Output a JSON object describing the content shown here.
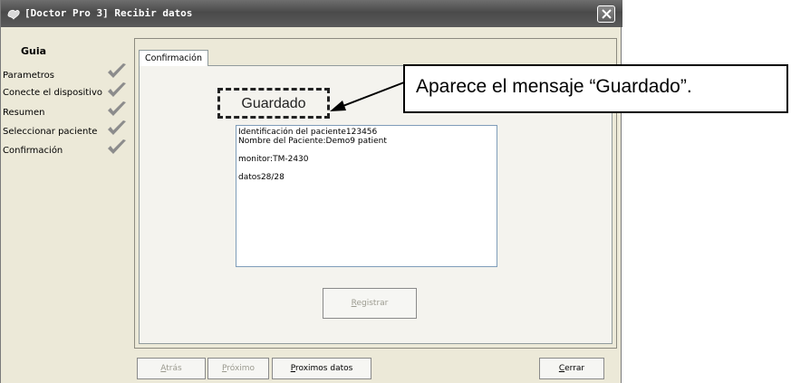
{
  "window": {
    "title": "[Doctor Pro 3] Recibir datos"
  },
  "guide": {
    "title": "Guia",
    "items": [
      {
        "label": "Parametros",
        "icon": "check-icon"
      },
      {
        "label": "Conecte el dispositivo",
        "icon": "check-icon"
      },
      {
        "label": "Resumen",
        "icon": "check-icon"
      },
      {
        "label": "Seleccionar paciente",
        "icon": "check-icon"
      },
      {
        "label": "Confirmación",
        "icon": "check-icon"
      }
    ]
  },
  "tab": {
    "label": "Confirmación"
  },
  "saved": {
    "label": "Guardado"
  },
  "info": {
    "line1": "Identificación del paciente123456",
    "line2": "Nombre del Paciente:Demo9 patient",
    "line3": "monitor:TM-2430",
    "line4": "datos28/28"
  },
  "buttons": {
    "register": {
      "prefix": "",
      "key": "R",
      "rest": "egistrar"
    },
    "back": {
      "prefix": "",
      "key": "A",
      "rest": "trás"
    },
    "next": {
      "prefix": "",
      "key": "P",
      "rest": "róximo"
    },
    "next_data": {
      "prefix": "",
      "key": "P",
      "rest": "roximos datos"
    },
    "close": {
      "prefix": "",
      "key": "C",
      "rest": "errar"
    }
  },
  "callout": {
    "text": "Aparece el mensaje “Guardado”."
  },
  "colors": {
    "titlebar": "#5a5a5a",
    "window_bg": "#ece9d8",
    "check": "#8c8c8c"
  }
}
